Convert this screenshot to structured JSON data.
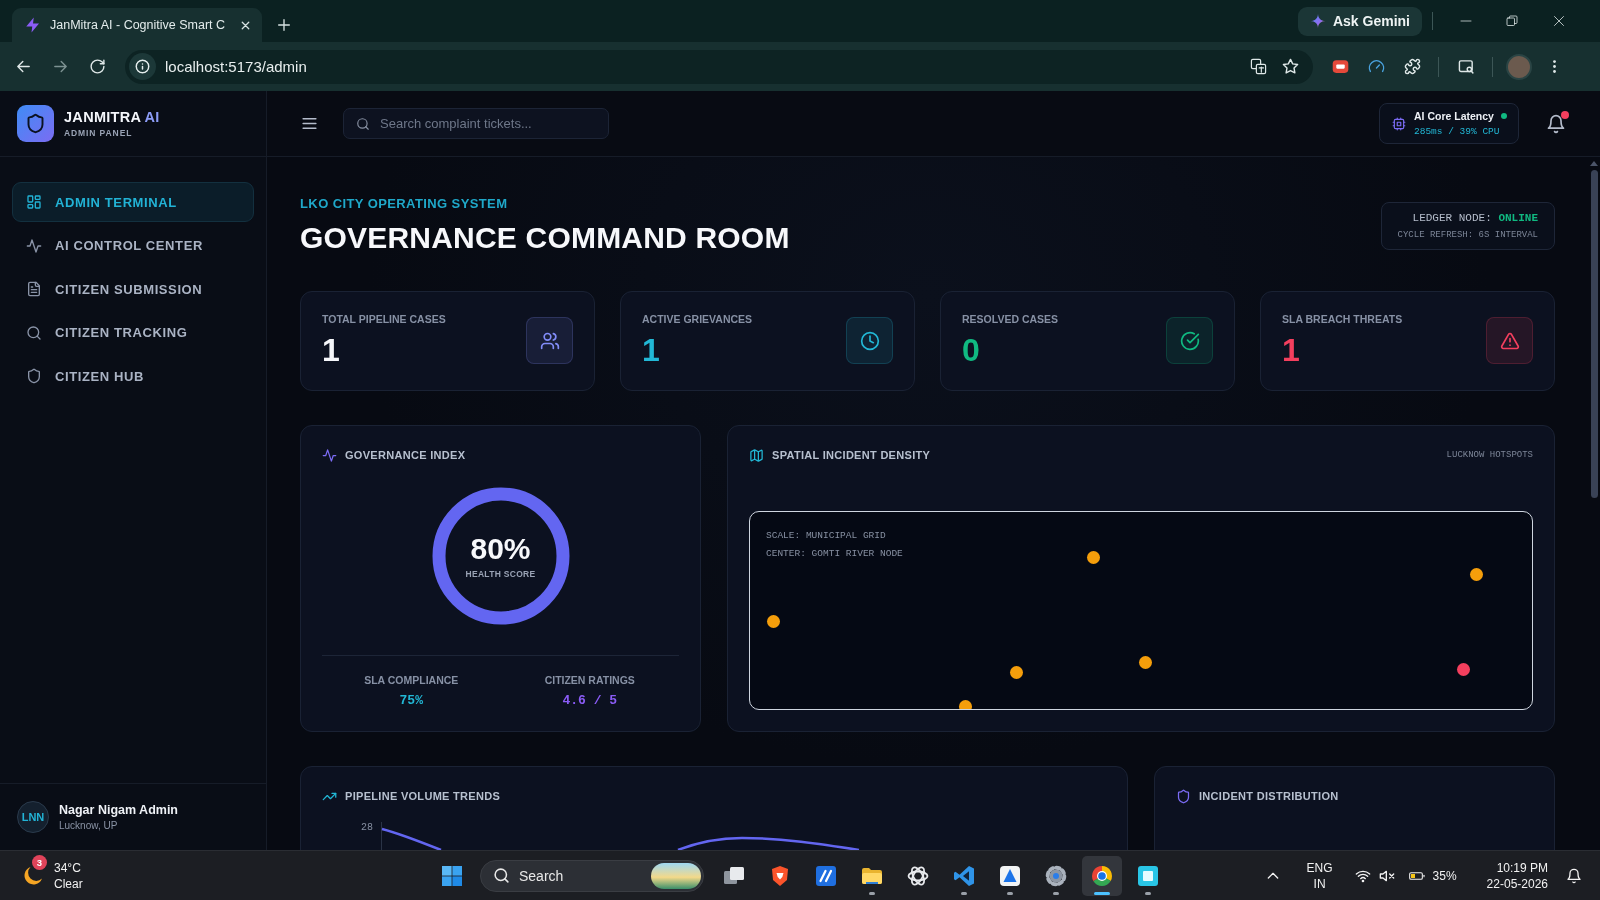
{
  "browser": {
    "tab": {
      "title": "JanMitra AI - Cognitive Smart C"
    },
    "gemini_label": "Ask Gemini",
    "forward_disabled": true,
    "url": "localhost:5173/admin"
  },
  "sidebar": {
    "brand": "JANMITRA *AI*",
    "subtitle": "ADMIN PANEL",
    "items": [
      {
        "label": "ADMIN TERMINAL",
        "selected": true
      },
      {
        "label": "AI CONTROL CENTER",
        "selected": false
      },
      {
        "label": "CITIZEN SUBMISSION",
        "selected": false
      },
      {
        "label": "CITIZEN TRACKING",
        "selected": false
      },
      {
        "label": "CITIZEN HUB",
        "selected": false
      }
    ],
    "user": {
      "initials": "LNN",
      "name": "Nagar Nigam Admin",
      "location": "Lucknow, UP"
    }
  },
  "header": {
    "search": {
      "placeholder": "Search complaint tickets..."
    },
    "latency": {
      "title": "AI Core Latency",
      "online": true,
      "reading": "285ms / 39% CPU"
    },
    "notifications": {
      "unread": true
    }
  },
  "page": {
    "kicker": "LKO CITY OPERATING SYSTEM",
    "title": "GOVERNANCE COMMAND ROOM",
    "ledger": {
      "status": "LEDGER NODE: **ONLINE**",
      "refresh": "CYCLE REFRESH: 6S INTERVAL"
    }
  },
  "cards": [
    {
      "label": "TOTAL PIPELINE CASES",
      "value": "1",
      "color": "#818cf8",
      "value_tinted": false
    },
    {
      "label": "ACTIVE GRIEVANCES",
      "value": "1",
      "color": "#22b8d6",
      "value_tinted": true
    },
    {
      "label": "RESOLVED CASES",
      "value": "0",
      "color": "#10b981",
      "value_tinted": true
    },
    {
      "label": "SLA BREACH THREATS",
      "value": "1",
      "color": "#f43f5e",
      "value_tinted": true
    }
  ],
  "governance": {
    "title": "GOVERNANCE INDEX",
    "score": "80%",
    "score_label": "HEALTH SCORE",
    "stats": [
      {
        "label": "SLA COMPLIANCE",
        "value": "75%",
        "color": "#22b8d6"
      },
      {
        "label": "CITIZEN RATINGS",
        "value": "4.6 / 5",
        "color": "#8b5cf6"
      }
    ]
  },
  "spatial": {
    "title": "SPATIAL INCIDENT DENSITY",
    "tag": "LUCKNOW HOTSPOTS",
    "map_notes": [
      "SCALE: MUNICIPAL GRID",
      "CENTER: GOMTI RIVER NODE"
    ],
    "hotspots": [
      {
        "color": "#f59e0b"
      },
      {
        "color": "#f59e0b"
      },
      {
        "color": "#f59e0b"
      },
      {
        "color": "#f59e0b"
      },
      {
        "color": "#f59e0b"
      },
      {
        "color": "#f43f5e"
      },
      {
        "color": "#f59e0b"
      }
    ]
  },
  "pipeline": {
    "title": "PIPELINE VOLUME TRENDS",
    "y_tick": "28"
  },
  "incident": {
    "title": "INCIDENT DISTRIBUTION"
  },
  "taskbar": {
    "weather": {
      "badge": "3",
      "temperature": "34°C",
      "condition": "Clear"
    },
    "search_label": "Search",
    "apps": [
      {
        "running": false,
        "selected": false
      },
      {
        "running": false,
        "selected": false
      },
      {
        "running": false,
        "selected": false
      },
      {
        "running": true,
        "selected": false
      },
      {
        "running": false,
        "selected": false
      },
      {
        "running": true,
        "selected": false
      },
      {
        "running": true,
        "selected": false
      },
      {
        "running": true,
        "selected": false
      },
      {
        "running": true,
        "selected": true
      },
      {
        "running": true,
        "selected": false
      }
    ],
    "input_language": {
      "language": "ENG",
      "region": "IN"
    },
    "battery": "35%",
    "time": "10:19 PM",
    "date": "22-05-2026"
  }
}
